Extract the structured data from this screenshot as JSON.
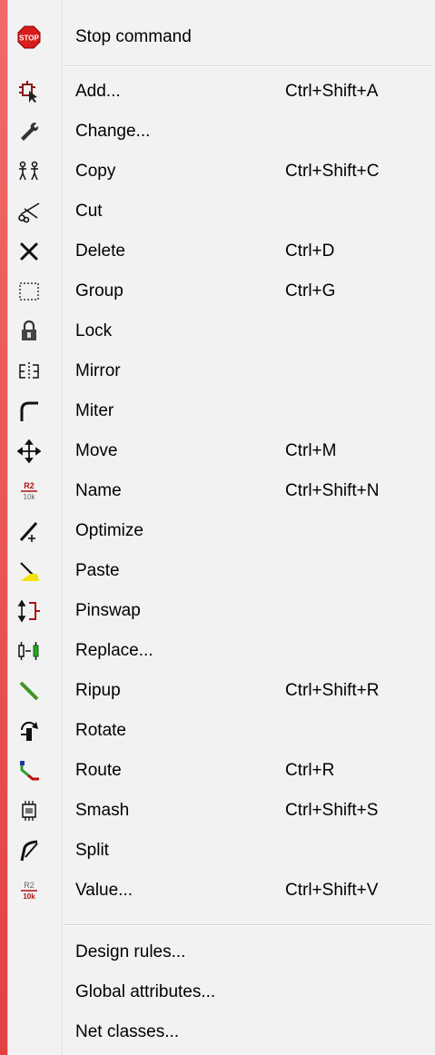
{
  "menu": {
    "top_item": {
      "label": "Stop command",
      "icon": "stop-icon"
    },
    "items": [
      {
        "label": "Add...",
        "shortcut": "Ctrl+Shift+A",
        "icon": "add-icon"
      },
      {
        "label": "Change...",
        "shortcut": "",
        "icon": "wrench-icon"
      },
      {
        "label": "Copy",
        "shortcut": "Ctrl+Shift+C",
        "icon": "copy-icon"
      },
      {
        "label": "Cut",
        "shortcut": "",
        "icon": "scissors-icon"
      },
      {
        "label": "Delete",
        "shortcut": "Ctrl+D",
        "icon": "delete-icon"
      },
      {
        "label": "Group",
        "shortcut": "Ctrl+G",
        "icon": "group-icon"
      },
      {
        "label": "Lock",
        "shortcut": "",
        "icon": "lock-icon"
      },
      {
        "label": "Mirror",
        "shortcut": "",
        "icon": "mirror-icon"
      },
      {
        "label": "Miter",
        "shortcut": "",
        "icon": "miter-icon"
      },
      {
        "label": "Move",
        "shortcut": "Ctrl+M",
        "icon": "move-icon"
      },
      {
        "label": "Name",
        "shortcut": "Ctrl+Shift+N",
        "icon": "name-icon"
      },
      {
        "label": "Optimize",
        "shortcut": "",
        "icon": "optimize-icon"
      },
      {
        "label": "Paste",
        "shortcut": "",
        "icon": "paste-icon"
      },
      {
        "label": "Pinswap",
        "shortcut": "",
        "icon": "pinswap-icon"
      },
      {
        "label": "Replace...",
        "shortcut": "",
        "icon": "replace-icon"
      },
      {
        "label": "Ripup",
        "shortcut": "Ctrl+Shift+R",
        "icon": "ripup-icon"
      },
      {
        "label": "Rotate",
        "shortcut": "",
        "icon": "rotate-icon"
      },
      {
        "label": "Route",
        "shortcut": "Ctrl+R",
        "icon": "route-icon"
      },
      {
        "label": "Smash",
        "shortcut": "Ctrl+Shift+S",
        "icon": "smash-icon"
      },
      {
        "label": "Split",
        "shortcut": "",
        "icon": "split-icon"
      },
      {
        "label": "Value...",
        "shortcut": "Ctrl+Shift+V",
        "icon": "value-icon"
      }
    ],
    "bottom_items": [
      {
        "label": "Design rules..."
      },
      {
        "label": "Global attributes..."
      },
      {
        "label": "Net classes..."
      }
    ],
    "icon_texts": {
      "stop": "STOP",
      "r2": "R2",
      "tenk": "10k"
    },
    "colors": {
      "background": "#f2f2f2",
      "frame": "#e84e4e",
      "stop_red": "#d91c1c"
    }
  }
}
